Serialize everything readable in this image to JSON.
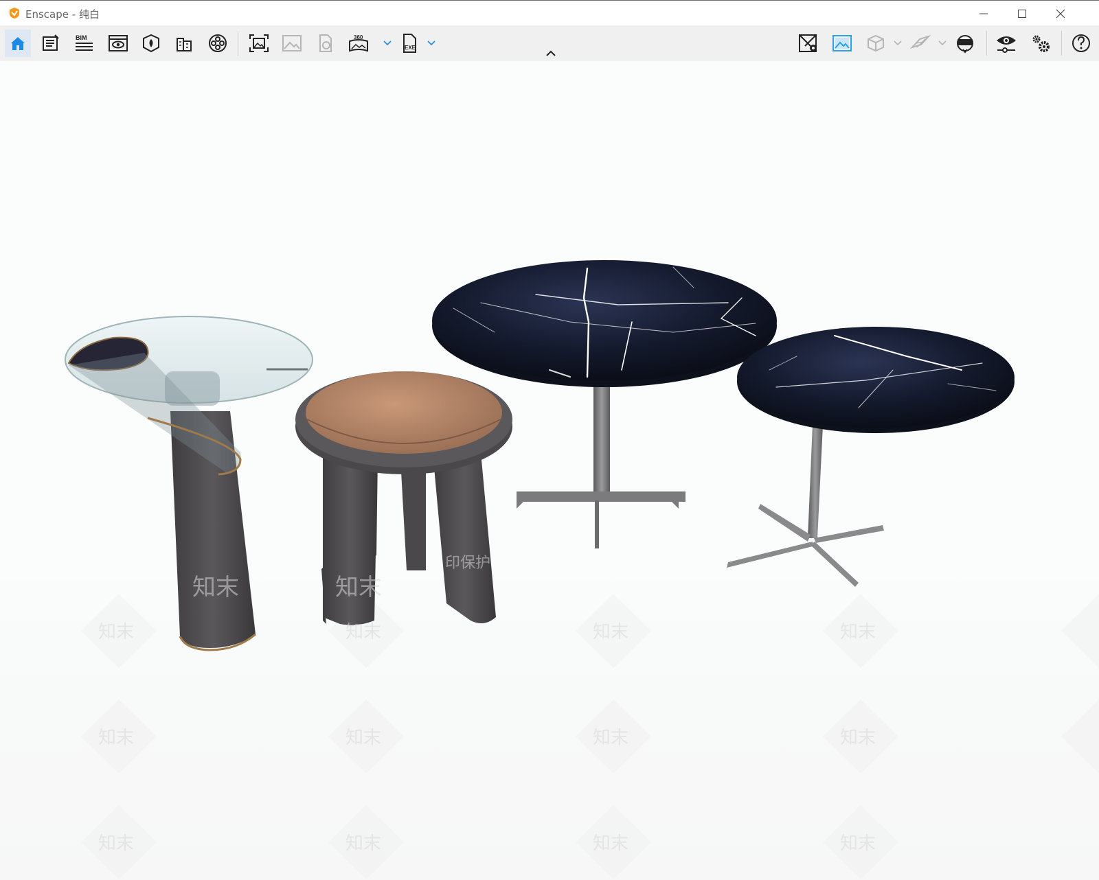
{
  "window": {
    "app_name": "Enscape",
    "separator": " - ",
    "document": "纯白",
    "minimize_label": "Minimize",
    "maximize_label": "Maximize",
    "close_label": "Close"
  },
  "toolbar": {
    "left_buttons": [
      {
        "name": "home",
        "icon": "home-icon",
        "active": true
      },
      {
        "name": "project-info",
        "icon": "notes-icon"
      },
      {
        "name": "bim-info",
        "icon": "bim-icon",
        "text": "BIM"
      },
      {
        "name": "views",
        "icon": "view-window-icon"
      },
      {
        "name": "material",
        "icon": "material-icon"
      },
      {
        "name": "asset-library",
        "icon": "building-icon"
      },
      {
        "name": "video",
        "icon": "film-reel-icon"
      },
      {
        "name": "screenshot",
        "icon": "screenshot-icon"
      },
      {
        "name": "batch-render",
        "icon": "image-icon",
        "disabled": true
      },
      {
        "name": "export-web",
        "icon": "file-export-icon",
        "disabled": true
      },
      {
        "name": "panorama",
        "icon": "panorama-360-icon",
        "text": "360"
      },
      {
        "name": "export-exe",
        "icon": "exe-export-icon",
        "text": "EXE"
      }
    ],
    "right_buttons": [
      {
        "name": "map",
        "icon": "map-pin-icon"
      },
      {
        "name": "capture",
        "icon": "capture-image-icon",
        "accent": "#2aa3e6"
      },
      {
        "name": "cube",
        "icon": "cube-icon",
        "disabled": true
      },
      {
        "name": "grid-plane",
        "icon": "plane-icon",
        "disabled": true
      },
      {
        "name": "vr",
        "icon": "vr-headset-icon"
      },
      {
        "name": "visual-settings",
        "icon": "eye-settings-icon"
      },
      {
        "name": "settings",
        "icon": "gears-icon"
      },
      {
        "name": "help",
        "icon": "help-icon"
      }
    ]
  },
  "colors": {
    "logo": "#f39a1e",
    "accent": "#1e88e5",
    "marble": "#141a2b",
    "leather": "#b88968",
    "wood": "#4f4d50"
  },
  "watermark": {
    "text": "知末",
    "text2": "印保护"
  }
}
